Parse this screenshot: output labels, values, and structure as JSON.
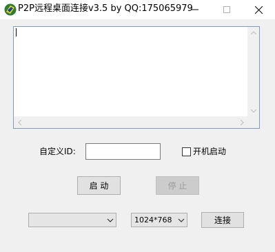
{
  "window": {
    "title": "P2P远程桌面连接v3.5 by QQ:175065979",
    "icons": {
      "app": "app-logo-icon",
      "minimize": "minimize-icon",
      "maximize": "maximize-icon",
      "close": "close-icon"
    }
  },
  "log": {
    "text": ""
  },
  "form": {
    "id_label": "自定义ID:",
    "id_value": "",
    "autostart_label": "开机启动",
    "autostart_checked": false,
    "start_label": "启 动",
    "stop_label": "停 止"
  },
  "connect": {
    "peer_selected": "",
    "resolution_selected": "1024*768",
    "connect_label": "连接"
  }
}
